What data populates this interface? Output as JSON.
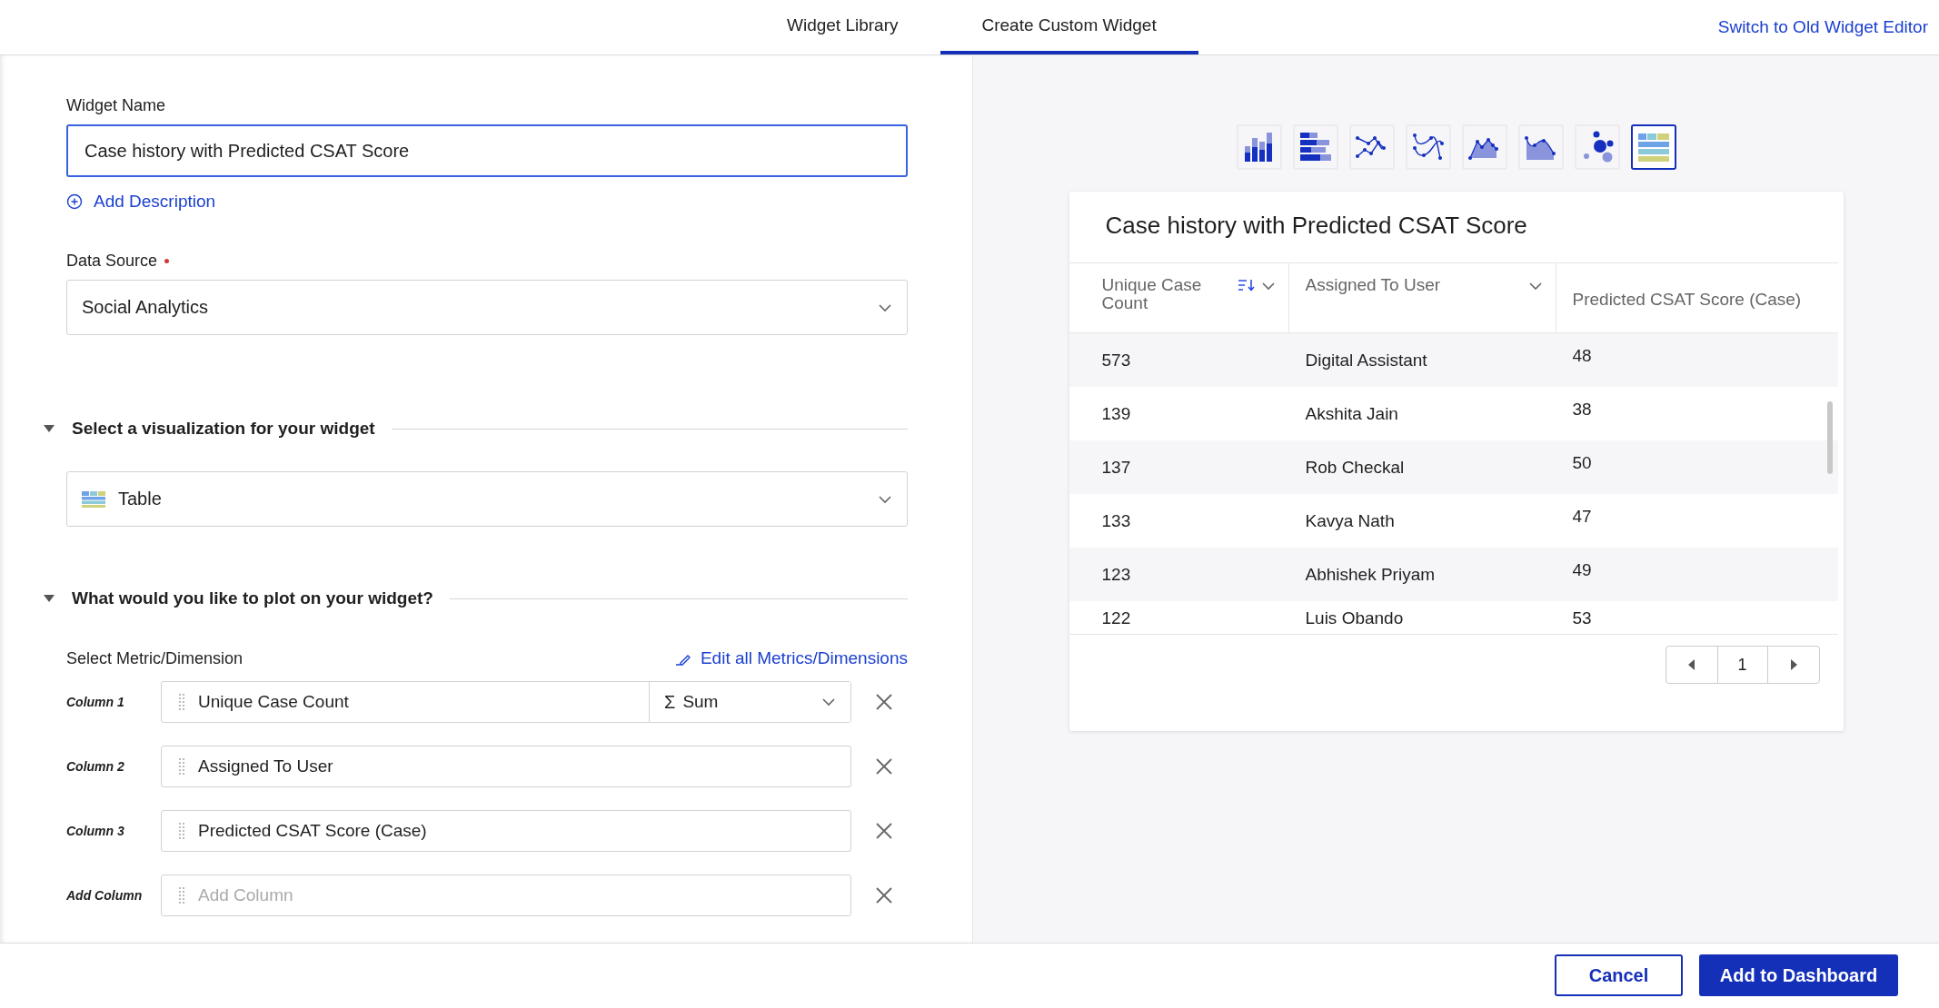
{
  "tabs": [
    {
      "label": "Widget Library",
      "selected": false
    },
    {
      "label": "Create Custom Widget",
      "selected": true
    }
  ],
  "header_link": "Switch to Old Widget Editor",
  "form": {
    "widget_name": {
      "label": "Widget Name",
      "value": "Case history with Predicted CSAT Score",
      "focused": true
    },
    "add_description": "Add Description",
    "data_source": {
      "label": "Data Source",
      "required": true,
      "value": "Social Analytics"
    },
    "visualization_section": {
      "title": "Select a visualization for your widget",
      "expanded": true,
      "value": "Table"
    },
    "plot_section": {
      "title": "What would you like to plot on your widget?",
      "expanded": true,
      "subtitle": "Select Metric/Dimension",
      "edit_link": "Edit all Metrics/Dimensions",
      "columns": [
        {
          "label": "Column 1",
          "value": "Unique Case Count",
          "aggregation_symbol": "Σ",
          "aggregation": "Sum"
        },
        {
          "label": "Column 2",
          "value": "Assigned To User"
        },
        {
          "label": "Column 3",
          "value": "Predicted CSAT Score (Case)"
        },
        {
          "label": "Add Column",
          "placeholder": "Add Column"
        }
      ]
    }
  },
  "chart_types": [
    {
      "kind": "column",
      "selected": false
    },
    {
      "kind": "bar",
      "selected": false
    },
    {
      "kind": "line",
      "selected": false
    },
    {
      "kind": "spline",
      "selected": false
    },
    {
      "kind": "area",
      "selected": false
    },
    {
      "kind": "spline-area",
      "selected": false
    },
    {
      "kind": "bubble",
      "selected": false
    },
    {
      "kind": "table",
      "selected": true
    }
  ],
  "preview": {
    "title": "Case history with Predicted CSAT Score",
    "columns": [
      {
        "label": "Unique Case Count",
        "sorted": true,
        "menu": true
      },
      {
        "label": "Assigned To User",
        "sorted": false,
        "menu": true
      },
      {
        "label": "Predicted CSAT Score (Case)",
        "sorted": false,
        "menu": false
      }
    ],
    "rows": [
      [
        "573",
        "Digital Assistant",
        "48"
      ],
      [
        "139",
        "Akshita Jain",
        "38"
      ],
      [
        "137",
        "Rob Checkal",
        "50"
      ],
      [
        "133",
        "Kavya Nath",
        "47"
      ],
      [
        "123",
        "Abhishek Priyam",
        "49"
      ],
      [
        "122",
        "Luis Obando",
        "53"
      ]
    ],
    "page": "1"
  },
  "footer": {
    "buttons": [
      {
        "label": "Cancel",
        "kind": "secondary"
      },
      {
        "label": "Add to Dashboard",
        "kind": "primary"
      }
    ]
  }
}
